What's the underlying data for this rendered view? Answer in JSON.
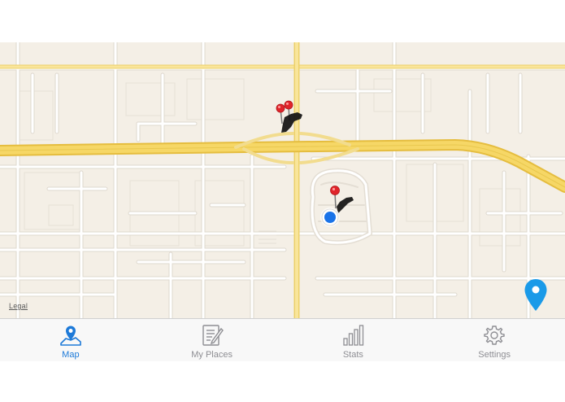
{
  "map": {
    "legal_label": "Legal",
    "colors": {
      "land": "#f4efe6",
      "street": "#ffffff",
      "street_outline": "#e0dbd2",
      "highway": "#f6d766",
      "highway_outline": "#e8c24a",
      "pin_red": "#e0242a",
      "user_location": "#1a73e8",
      "place_marker": "#1a9ae8"
    },
    "markers": [
      {
        "name": "red-pin",
        "icon": "red-pin-icon"
      },
      {
        "name": "user-location-dot",
        "icon": "location-dot-icon"
      },
      {
        "name": "blue-place-marker",
        "icon": "map-marker-icon"
      }
    ]
  },
  "tabbar": {
    "accent": "#1e7ad8",
    "inactive": "#8e8e93",
    "tabs": [
      {
        "label": "Map",
        "icon": "map-icon",
        "active": true
      },
      {
        "label": "My Places",
        "icon": "notepad-icon",
        "active": false
      },
      {
        "label": "Stats",
        "icon": "bar-chart-icon",
        "active": false
      },
      {
        "label": "Settings",
        "icon": "gear-icon",
        "active": false
      }
    ]
  }
}
